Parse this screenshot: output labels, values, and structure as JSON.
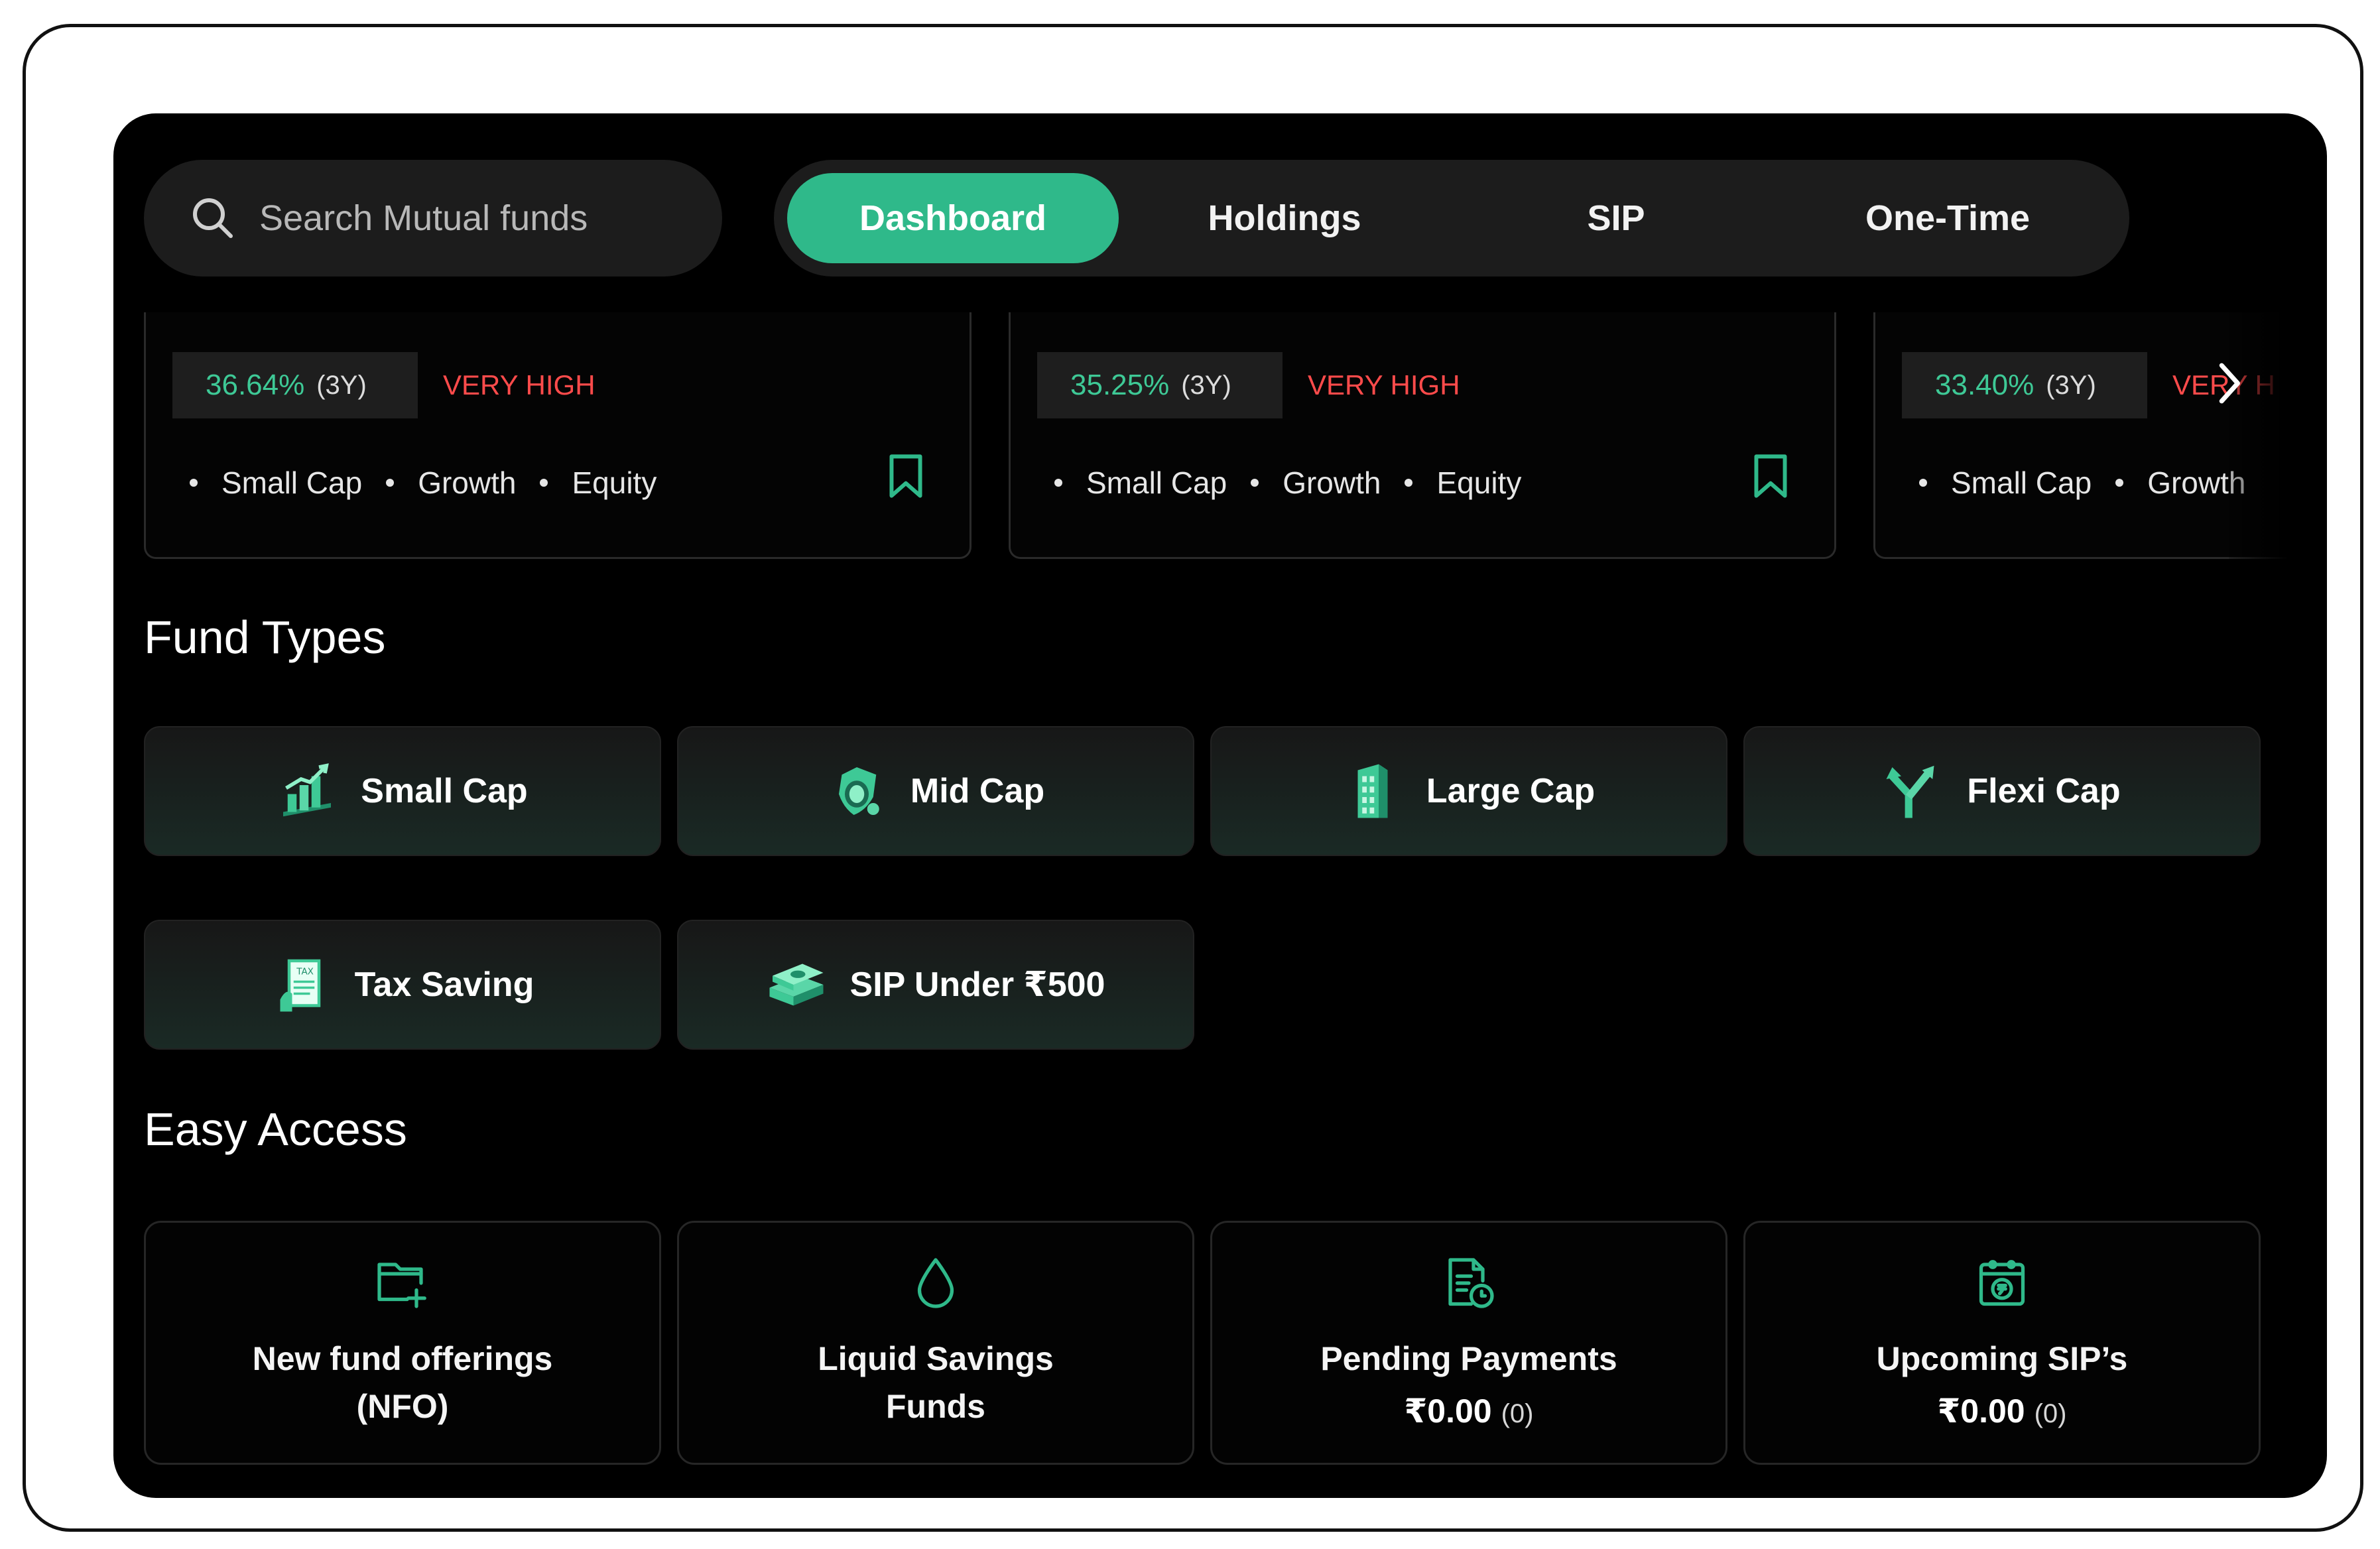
{
  "search": {
    "placeholder": "Search Mutual funds"
  },
  "tabs": [
    {
      "label": "Dashboard",
      "active": true
    },
    {
      "label": "Holdings",
      "active": false
    },
    {
      "label": "SIP",
      "active": false
    },
    {
      "label": "One-Time",
      "active": false
    }
  ],
  "fund_cards": [
    {
      "return_pct": "36.64%",
      "period": "(3Y)",
      "risk": "VERY HIGH",
      "tags": [
        "Small Cap",
        "Growth",
        "Equity"
      ]
    },
    {
      "return_pct": "35.25%",
      "period": "(3Y)",
      "risk": "VERY HIGH",
      "tags": [
        "Small Cap",
        "Growth",
        "Equity"
      ]
    },
    {
      "return_pct": "33.40%",
      "period": "(3Y)",
      "risk": "VERY H",
      "tags": [
        "Small Cap",
        "Growth"
      ]
    }
  ],
  "fund_types": {
    "title": "Fund Types",
    "items": [
      {
        "label": "Small Cap",
        "icon": "bar-chart-icon"
      },
      {
        "label": "Mid Cap",
        "icon": "coin-shield-icon"
      },
      {
        "label": "Large Cap",
        "icon": "building-icon"
      },
      {
        "label": "Flexi Cap",
        "icon": "split-arrow-icon"
      },
      {
        "label": "Tax Saving",
        "icon": "tax-document-icon"
      },
      {
        "label": "SIP Under ₹500",
        "icon": "money-stack-icon"
      }
    ]
  },
  "easy_access": {
    "title": "Easy Access",
    "items": [
      {
        "line1": "New fund offerings",
        "line2": "(NFO)",
        "icon": "folder-plus-icon"
      },
      {
        "line1": "Liquid Savings",
        "line2": "Funds",
        "icon": "droplet-icon"
      },
      {
        "line1": "Pending Payments",
        "amount": "₹0.00",
        "count": "(0)",
        "icon": "invoice-clock-icon"
      },
      {
        "line1": "Upcoming SIP’s",
        "amount": "₹0.00",
        "count": "(0)",
        "icon": "calendar-rupee-icon"
      }
    ]
  },
  "colors": {
    "accent": "#2fb98a",
    "positive": "#3ec996",
    "risk": "#ff4b4b",
    "background": "#000000"
  }
}
